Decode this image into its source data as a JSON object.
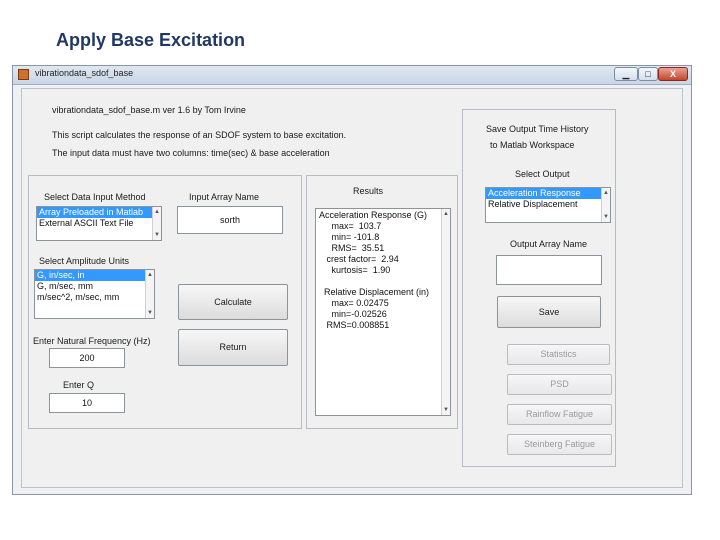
{
  "slide": {
    "title": "Apply Base Excitation"
  },
  "window": {
    "title": "vibrationdata_sdof_base",
    "controls": {
      "minimize": "▁",
      "maximize": "□",
      "close": "X"
    }
  },
  "header": {
    "line1": "vibrationdata_sdof_base.m   ver 1.6  by Tom Irvine",
    "line2": "This script calculates the response of an SDOF system to base excitation.",
    "line3": "The input data must have two columns:  time(sec) & base acceleration"
  },
  "input_method": {
    "label": "Select Data Input Method",
    "options": [
      "Array Preloaded in Matlab",
      "External ASCII Text File"
    ],
    "selected_index": 0
  },
  "input_array": {
    "label": "Input Array Name",
    "value": "sorth"
  },
  "amplitude_units": {
    "label": "Select Amplitude Units",
    "options": [
      "G, in/sec, in",
      "G, m/sec, mm",
      "m/sec^2, m/sec, mm"
    ],
    "selected_index": 0
  },
  "natural_frequency": {
    "label": "Enter Natural Frequency (Hz)",
    "value": "200"
  },
  "damping": {
    "label": "Enter Q",
    "value": "10"
  },
  "buttons": {
    "calculate": "Calculate",
    "return": "Return"
  },
  "results": {
    "label": "Results",
    "lines": [
      "Acceleration Response (G)",
      "     max=  103.7",
      "     min= -101.8",
      "     RMS=  35.51",
      "   crest factor=  2.94",
      "     kurtosis=  1.90",
      "",
      "  Relative Displacement (in)",
      "     max= 0.02475",
      "     min=-0.02526",
      "   RMS=0.008851"
    ]
  },
  "save_panel": {
    "heading_line1": "Save Output Time History",
    "heading_line2": "to Matlab Workspace",
    "select_output_label": "Select Output",
    "output_options": [
      "Acceleration Response",
      "Relative Displacement"
    ],
    "selected_index": 0,
    "array_name_label": "Output Array Name",
    "array_name_value": "",
    "save_button": "Save"
  },
  "analysis_buttons": {
    "statistics": "Statistics",
    "psd": "PSD",
    "rainflow": "Rainflow Fatigue",
    "steinberg": "Steinberg Fatigue"
  }
}
